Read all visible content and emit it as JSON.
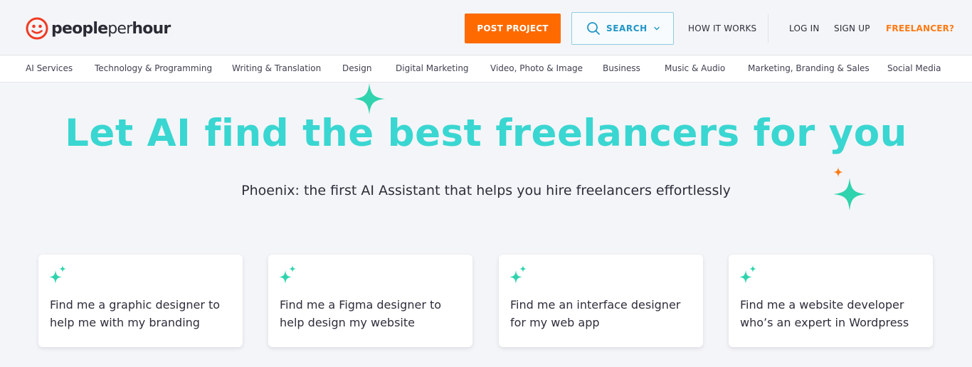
{
  "header": {
    "logo": {
      "part1": "people",
      "part2": "per",
      "part3": "hour"
    },
    "post_project_label": "POST PROJECT",
    "search_label": "SEARCH",
    "how_it_works_label": "HOW IT WORKS",
    "login_label": "LOG IN",
    "signup_label": "SIGN UP",
    "freelancer_label": "FREELANCER?"
  },
  "categories": [
    "AI Services",
    "Technology & Programming",
    "Writing & Translation",
    "Design",
    "Digital Marketing",
    "Video, Photo & Image",
    "Business",
    "Music & Audio",
    "Marketing, Branding & Sales",
    "Social Media"
  ],
  "hero": {
    "title": "Let AI find the best freelancers for you",
    "subtitle": "Phoenix: the first AI Assistant that helps you hire freelancers effortlessly"
  },
  "suggestions": [
    {
      "line1": "Find me a graphic designer to",
      "line2": "help me with my branding"
    },
    {
      "line1": "Find me a Figma designer to",
      "line2": "help design my website"
    },
    {
      "line1": "Find me an interface designer",
      "line2": "for my web app"
    },
    {
      "line1": "Find me a website developer",
      "line2": "who’s an expert in Wordpress"
    }
  ],
  "colors": {
    "brand_orange": "#ff6a00",
    "hero_teal": "#3ad6d1",
    "sparkle_green": "#2fd3ad",
    "search_blue": "#2196c8"
  },
  "icons": [
    "logo-face-icon",
    "search-icon",
    "chevron-down-icon",
    "sparkle-icon"
  ]
}
